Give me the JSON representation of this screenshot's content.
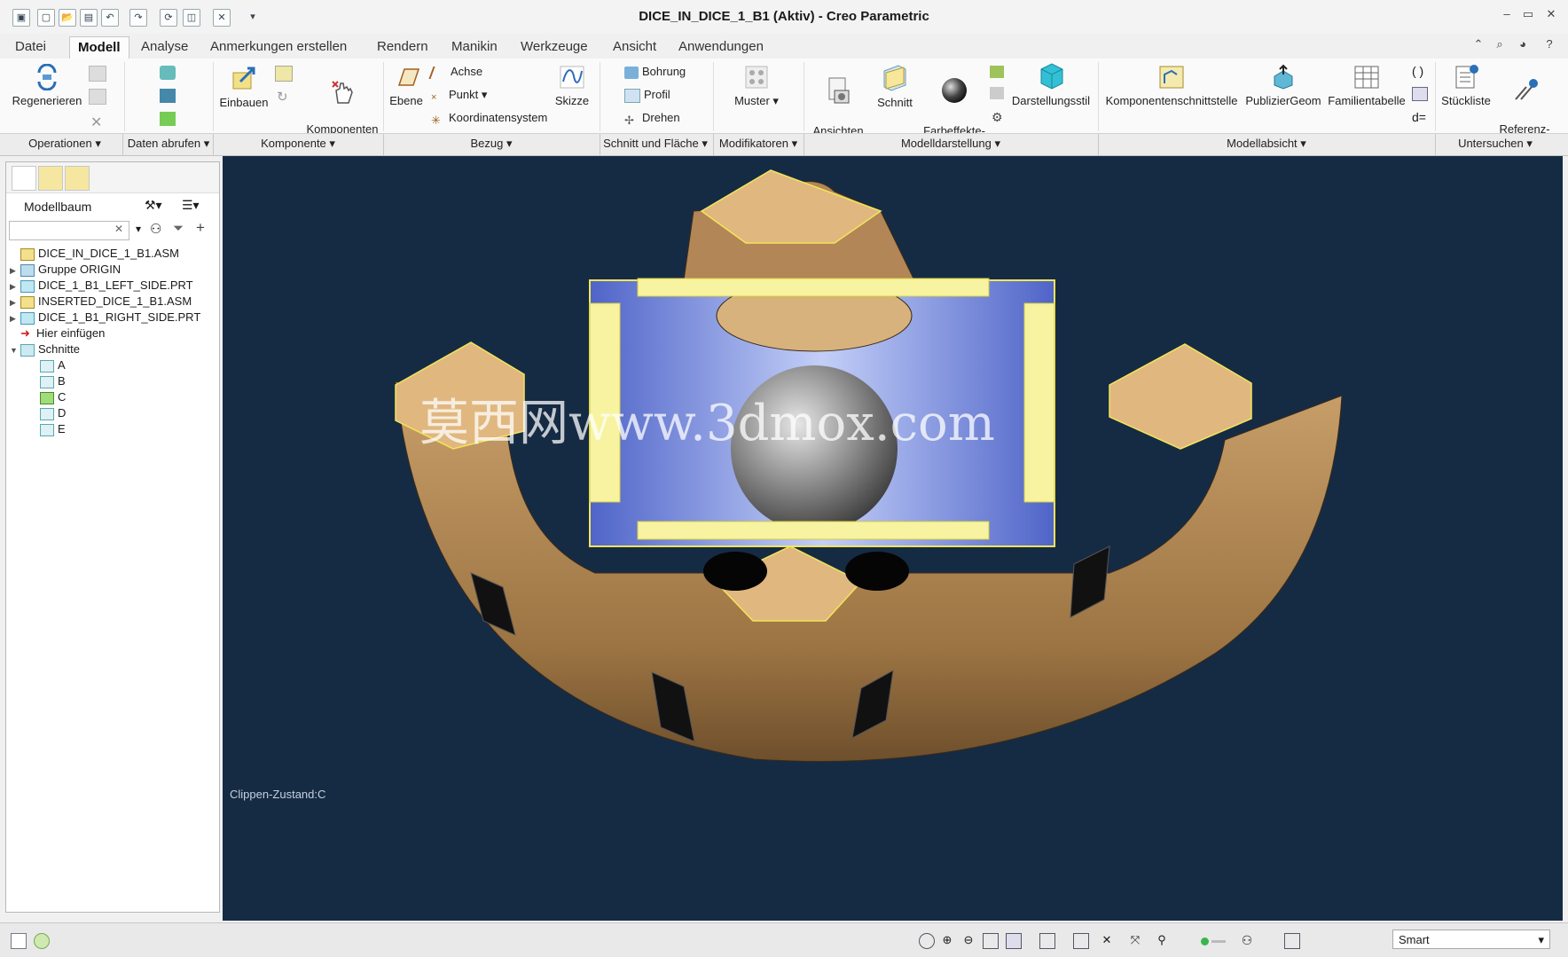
{
  "window": {
    "title": "DICE_IN_DICE_1_B1 (Aktiv) - Creo Parametric"
  },
  "ribbon_tabs": [
    "Datei",
    "Modell",
    "Analyse",
    "Anmerkungen erstellen",
    "Rendern",
    "Manikin",
    "Werkzeuge",
    "Ansicht",
    "Anwendungen"
  ],
  "active_tab": "Modell",
  "ribbon_commands": {
    "regenerieren": "Regenerieren",
    "einbauen": "Einbauen",
    "komponenten_ziehen": "Komponenten\nziehen",
    "ebene": "Ebene",
    "achse": "Achse",
    "punkt": "Punkt",
    "koordinatensystem": "Koordinatensystem",
    "skizze": "Skizze",
    "bohrung": "Bohrung",
    "profil": "Profil",
    "drehen": "Drehen",
    "muster": "Muster",
    "ansichten_verwalten": "Ansichten\nverwalten",
    "schnitt": "Schnitt",
    "farbeffekte_galerie": "Farbeffekte-\nGalerie",
    "darstellungsstil": "Darstellungsstil",
    "komponentenschnittstelle": "Komponentenschnittstelle",
    "publiziergeom": "PublizierGeom",
    "familientabelle": "Familientabelle",
    "stueckliste": "Stückliste",
    "referenz_viewer": "Referenz-\nViewer"
  },
  "ribbon_groups": [
    "Operationen",
    "Daten abrufen",
    "Komponente",
    "Bezug",
    "Schnitt und Fläche",
    "Modifikatoren",
    "Modelldarstellung",
    "Modellabsicht",
    "Untersuchen"
  ],
  "model_tree": {
    "title": "Modellbaum",
    "search_value": "",
    "items": [
      {
        "label": "DICE_IN_DICE_1_B1.ASM",
        "level": 0,
        "expander": "",
        "icon": "assembly-icon"
      },
      {
        "label": "Gruppe ORIGIN",
        "level": 0,
        "expander": "▶",
        "icon": "group-icon"
      },
      {
        "label": "DICE_1_B1_LEFT_SIDE.PRT",
        "level": 0,
        "expander": "▶",
        "icon": "part-icon"
      },
      {
        "label": "INSERTED_DICE_1_B1.ASM",
        "level": 0,
        "expander": "▶",
        "icon": "assembly-icon"
      },
      {
        "label": "DICE_1_B1_RIGHT_SIDE.PRT",
        "level": 0,
        "expander": "▶",
        "icon": "part-icon"
      },
      {
        "label": "Hier einfügen",
        "level": 0,
        "expander": "",
        "icon": "insert-arrow-icon"
      },
      {
        "label": "Schnitte",
        "level": 0,
        "expander": "▼",
        "icon": "sections-icon"
      },
      {
        "label": "A",
        "level": 1,
        "expander": "",
        "icon": "section-icon"
      },
      {
        "label": "B",
        "level": 1,
        "expander": "",
        "icon": "section-icon"
      },
      {
        "label": "C",
        "level": 1,
        "expander": "",
        "icon": "section-active-icon"
      },
      {
        "label": "D",
        "level": 1,
        "expander": "",
        "icon": "section-icon"
      },
      {
        "label": "E",
        "level": 1,
        "expander": "",
        "icon": "section-icon"
      }
    ]
  },
  "viewport": {
    "clip_status": "Clippen-Zustand:C",
    "watermark": "莫西网www.3dmox.com",
    "background_color": "#152b44"
  },
  "status_bar": {
    "selection_filter": "Smart"
  },
  "colors": {
    "ribbon_bg": "#fafafa",
    "model_tan": "#d7b27c",
    "model_blue": "#6f86e0",
    "highlight_yellow": "#f8f3a0"
  }
}
